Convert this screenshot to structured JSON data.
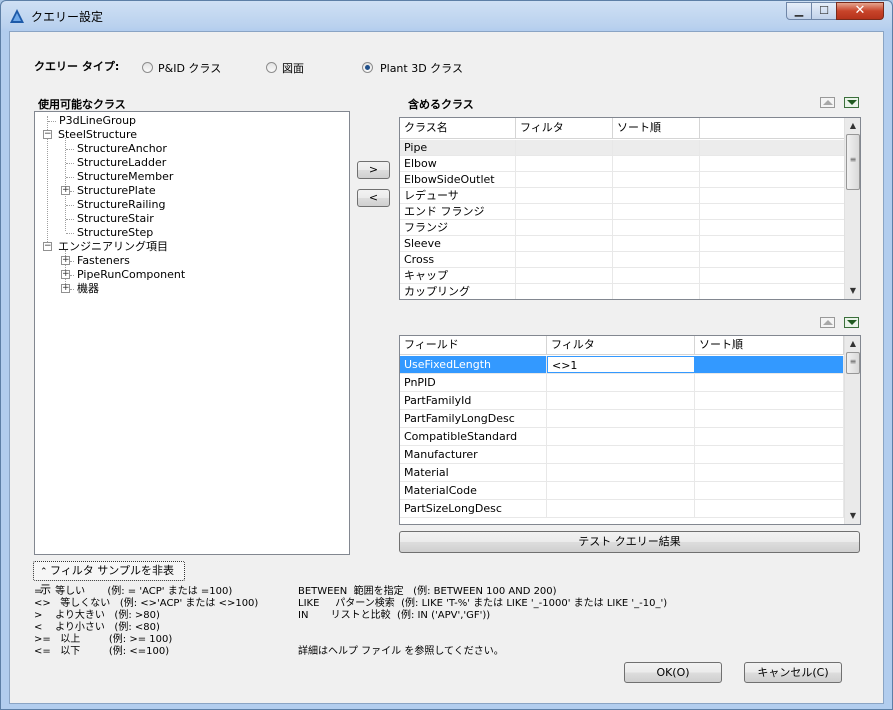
{
  "window": {
    "title": "クエリー設定",
    "min_glyph": "▁",
    "max_glyph": "☐",
    "close_glyph": "✕"
  },
  "query_type": {
    "label": "クエリー タイプ:",
    "options": [
      {
        "label": "P&ID クラス",
        "selected": false
      },
      {
        "label": "図面",
        "selected": false
      },
      {
        "label": "Plant 3D クラス",
        "selected": true
      }
    ]
  },
  "available": {
    "title": "使用可能なクラス",
    "tree": [
      {
        "label": "P3dLineGroup"
      },
      {
        "label": "SteelStructure"
      },
      {
        "label": "StructureAnchor"
      },
      {
        "label": "StructureLadder"
      },
      {
        "label": "StructureMember"
      },
      {
        "label": "StructurePlate"
      },
      {
        "label": "StructureRailing"
      },
      {
        "label": "StructureStair"
      },
      {
        "label": "StructureStep"
      },
      {
        "label": "エンジニアリング項目"
      },
      {
        "label": "Fasteners"
      },
      {
        "label": "PipeRunComponent"
      },
      {
        "label": "機器"
      }
    ]
  },
  "move": {
    "add": ">",
    "remove": "<"
  },
  "included": {
    "title": "含めるクラス",
    "columns": [
      "クラス名",
      "フィルタ",
      "ソート順"
    ],
    "rows": [
      {
        "name": "Pipe",
        "filter": "",
        "sort": ""
      },
      {
        "name": "Elbow",
        "filter": "",
        "sort": ""
      },
      {
        "name": "ElbowSideOutlet",
        "filter": "",
        "sort": ""
      },
      {
        "name": "レデューサ",
        "filter": "",
        "sort": ""
      },
      {
        "name": "エンド フランジ",
        "filter": "",
        "sort": ""
      },
      {
        "name": "フランジ",
        "filter": "",
        "sort": ""
      },
      {
        "name": "Sleeve",
        "filter": "",
        "sort": ""
      },
      {
        "name": "Cross",
        "filter": "",
        "sort": ""
      },
      {
        "name": "キャップ",
        "filter": "",
        "sort": ""
      },
      {
        "name": "カップリング",
        "filter": "",
        "sort": ""
      }
    ]
  },
  "fields": {
    "columns": [
      "フィールド",
      "フィルタ",
      "ソート順"
    ],
    "rows": [
      {
        "name": "UseFixedLength",
        "filter": "<>1",
        "sort": ""
      },
      {
        "name": "PnPID",
        "filter": "",
        "sort": ""
      },
      {
        "name": "PartFamilyId",
        "filter": "",
        "sort": ""
      },
      {
        "name": "PartFamilyLongDesc",
        "filter": "",
        "sort": ""
      },
      {
        "name": "CompatibleStandard",
        "filter": "",
        "sort": ""
      },
      {
        "name": "Manufacturer",
        "filter": "",
        "sort": ""
      },
      {
        "name": "Material",
        "filter": "",
        "sort": ""
      },
      {
        "name": "MaterialCode",
        "filter": "",
        "sort": ""
      },
      {
        "name": "PartSizeLongDesc",
        "filter": "",
        "sort": ""
      }
    ]
  },
  "test_button": "テスト クエリー結果",
  "filter_toggle": "フィルタ サンプルを非表示",
  "samples": {
    "left": "=    等しい       (例: = 'ACP' または =100)\n<>   等しくない   (例: <>'ACP' または <>100)\n>    より大きい   (例: >80)\n<    より小さい   (例: <80)\n>=   以上         (例: >= 100)\n<=   以下         (例: <=100)",
    "right": "BETWEEN  範囲を指定   (例: BETWEEN 100 AND 200)\nLIKE     パターン検索  (例: LIKE 'T-%' または LIKE '_-1000' または LIKE '_-10_')\nIN       リストと比較  (例: IN ('APV','GF'))",
    "help": "詳細はヘルプ ファイル を参照してください。"
  },
  "ok": "OK(O)",
  "cancel": "キャンセル(C)"
}
